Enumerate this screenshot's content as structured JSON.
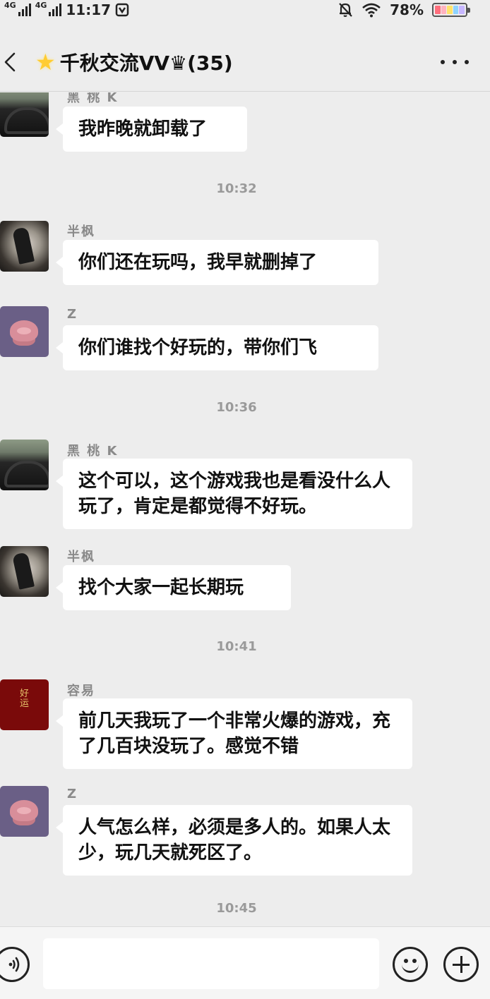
{
  "status_bar": {
    "network_1": "4G",
    "network_2": "4G",
    "time": "11:17",
    "battery_percent": "78%",
    "battery_colors": [
      "#ff6f7d",
      "#ffb3c0",
      "#ffe36b",
      "#8fd3ff",
      "#c7b7ff"
    ],
    "icons": [
      "signal-icon",
      "signal-icon",
      "notification-icon",
      "mute-icon",
      "wifi-icon",
      "battery-icon"
    ]
  },
  "header": {
    "title": "千秋交流VV♛(35)",
    "back_icon": "chevron-left-icon",
    "more_icon": "more-dots-icon"
  },
  "messages": [
    {
      "name": "黑 桃 K",
      "text": "我昨晚就卸载了"
    },
    {
      "time": "10:32"
    },
    {
      "name": "半枫",
      "text": "你们还在玩吗，我早就删掉了"
    },
    {
      "name": "Z",
      "text": "你们谁找个好玩的，带你们飞"
    },
    {
      "time": "10:36"
    },
    {
      "name": "黑 桃 K",
      "text": "这个可以，这个游戏我也是看没什么人玩了，肯定是都觉得不好玩。"
    },
    {
      "name": "半枫",
      "text": "找个大家一起长期玩"
    },
    {
      "time": "10:41"
    },
    {
      "name": "容易",
      "text": "前几天我玩了一个非常火爆的游戏，充了几百块没玩了。感觉不错",
      "avatar_text": [
        "好",
        "运"
      ]
    },
    {
      "name": "Z",
      "text": "人气怎么样，必须是多人的。如果人太少，玩几天就死区了。"
    },
    {
      "time": "10:45"
    }
  ],
  "input_bar": {
    "voice_icon": "voice-icon",
    "emoji_icon": "emoji-icon",
    "plus_icon": "plus-icon"
  }
}
